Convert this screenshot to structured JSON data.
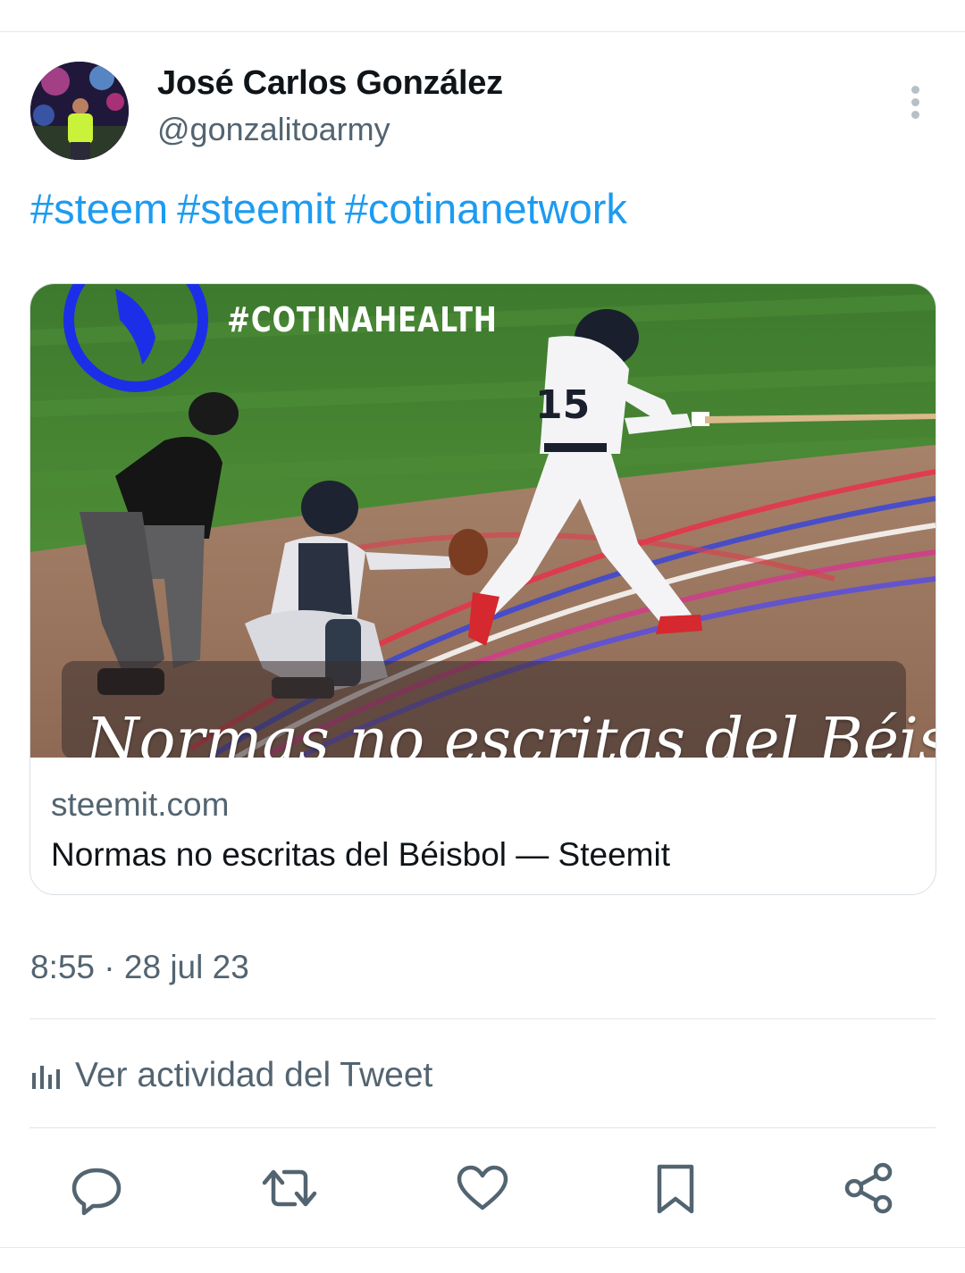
{
  "tweet": {
    "author": {
      "display_name": "José Carlos González",
      "handle": "@gonzalitoarmy"
    },
    "hashtags": [
      "#steem",
      "#steemit",
      "#cotinanetwork"
    ],
    "card": {
      "image_hashtag": "#COTINAHEALTH",
      "image_script_title": "Normas no escritas del Béisbol",
      "domain": "steemit.com",
      "title": "Normas no escritas del Béisbol — Steemit"
    },
    "timestamp": "8:55 · 28 jul 23",
    "activity_label": "Ver actividad del Tweet"
  },
  "actions": [
    {
      "name": "reply",
      "icon": "reply-icon"
    },
    {
      "name": "retweet",
      "icon": "retweet-icon"
    },
    {
      "name": "like",
      "icon": "heart-icon"
    },
    {
      "name": "bookmark",
      "icon": "bookmark-icon"
    },
    {
      "name": "share",
      "icon": "share-icon"
    }
  ],
  "colors": {
    "link": "#1d9bf0",
    "secondary_text": "#536471",
    "primary_text": "#0f1419",
    "icon": "#536471",
    "divider": "#e1e5e8"
  }
}
